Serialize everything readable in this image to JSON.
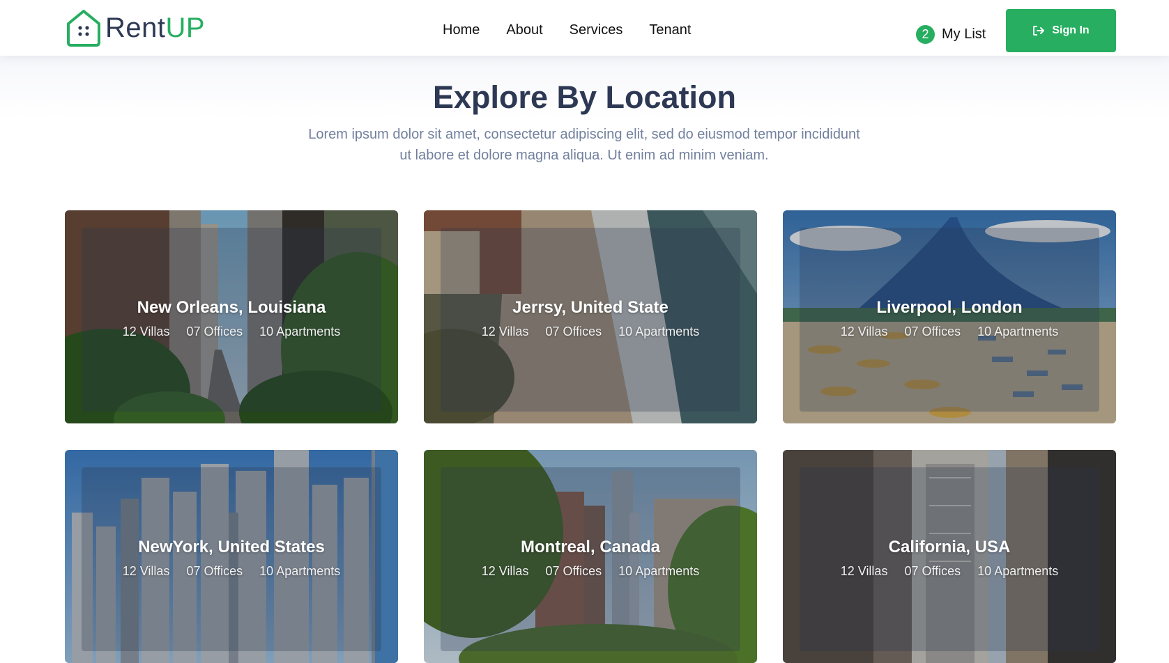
{
  "brand": {
    "name_dark": "Rent",
    "name_green": "UP",
    "accent": "#27ae60"
  },
  "nav": {
    "items": [
      {
        "label": "Home"
      },
      {
        "label": "About"
      },
      {
        "label": "Services"
      },
      {
        "label": "Tenant"
      }
    ]
  },
  "mylist": {
    "count": "2",
    "label": "My List"
  },
  "signin": {
    "label": "Sign In",
    "icon": "sign-in-icon"
  },
  "section": {
    "title": "Explore By Location",
    "subtitle_line1": "Lorem ipsum dolor sit amet, consectetur adipiscing elit, sed do eiusmod tempor incididunt",
    "subtitle_line2": "ut labore et dolore magna aliqua. Ut enim ad minim veniam."
  },
  "locations": [
    {
      "name": "New Orleans, Louisiana",
      "villas": "12 Villas",
      "offices": "07 Offices",
      "apartments": "10 Apartments"
    },
    {
      "name": "Jerrsy, United State",
      "villas": "12 Villas",
      "offices": "07 Offices",
      "apartments": "10 Apartments"
    },
    {
      "name": "Liverpool, London",
      "villas": "12 Villas",
      "offices": "07 Offices",
      "apartments": "10 Apartments"
    },
    {
      "name": "NewYork, United States",
      "villas": "12 Villas",
      "offices": "07 Offices",
      "apartments": "10 Apartments"
    },
    {
      "name": "Montreal, Canada",
      "villas": "12 Villas",
      "offices": "07 Offices",
      "apartments": "10 Apartments"
    },
    {
      "name": "California, USA",
      "villas": "12 Villas",
      "offices": "07 Offices",
      "apartments": "10 Apartments"
    }
  ]
}
